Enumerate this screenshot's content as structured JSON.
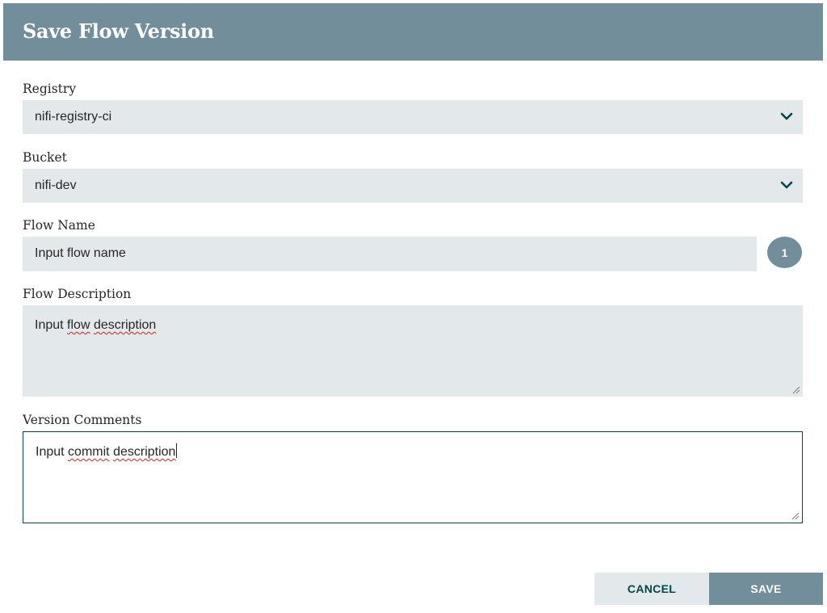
{
  "dialog": {
    "title": "Save Flow Version"
  },
  "registry": {
    "label": "Registry",
    "value": "nifi-registry-ci",
    "icon": "chevron-down-icon"
  },
  "bucket": {
    "label": "Bucket",
    "value": "nifi-dev",
    "icon": "chevron-down-icon"
  },
  "flow_name": {
    "label": "Flow Name",
    "value": "Input flow name",
    "badge": "1"
  },
  "flow_description": {
    "label": "Flow Description",
    "value_word1": "Input",
    "value_word2": "flow",
    "value_word3": "description"
  },
  "version_comments": {
    "label": "Version Comments",
    "value_word1": "Input",
    "value_word2": "commit",
    "value_word3": "description"
  },
  "buttons": {
    "cancel": "CANCEL",
    "save": "SAVE"
  },
  "colors": {
    "header": "#728e9b",
    "field_bg": "#e3e8eb",
    "focus_border": "#004849",
    "accent_text": "#004849"
  }
}
